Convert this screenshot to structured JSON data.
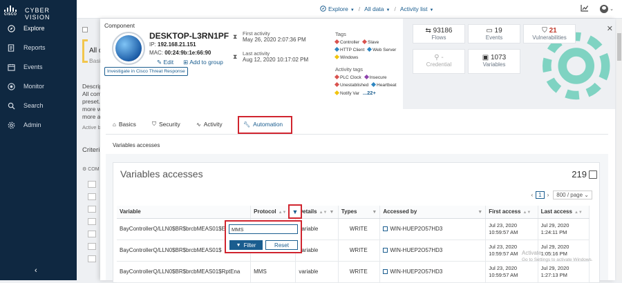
{
  "sidebar": {
    "brand": "CYBER VISION",
    "logo_text": "CISCO",
    "items": [
      {
        "label": "Explore",
        "icon": "compass-icon"
      },
      {
        "label": "Reports",
        "icon": "report-icon"
      },
      {
        "label": "Events",
        "icon": "calendar-icon"
      },
      {
        "label": "Monitor",
        "icon": "monitor-icon"
      },
      {
        "label": "Search",
        "icon": "search-icon"
      },
      {
        "label": "Admin",
        "icon": "gear-icon"
      }
    ],
    "collapse": "‹"
  },
  "topbar": {
    "crumbs": [
      "Explore",
      "All data",
      "Activity list"
    ],
    "chart_icon": "chart-icon",
    "user_icon": "user-icon"
  },
  "background": {
    "all_d": "All d",
    "basic": "Basic",
    "descript": "Descript",
    "line1": "All comp",
    "line2": "preset. T",
    "line3": "more w",
    "line4": "more ac",
    "active": "Active b",
    "criteria": "Criteri",
    "com": "COM"
  },
  "component": {
    "label": "Component",
    "name": "DESKTOP-L3RN1PF",
    "ip_label": "IP:",
    "ip": "192.168.21.151",
    "mac_label": "MAC:",
    "mac": "00:24:9b:1e:66:90",
    "edit": "Edit",
    "add_group": "Add to group",
    "investigate": "Investigate in Cisco Threat Response",
    "first_activity_label": "First activity",
    "first_activity": "May 26, 2020 2:07:36 PM",
    "last_activity_label": "Last activity",
    "last_activity": "Aug 12, 2020 10:17:02 PM",
    "tags_label": "Tags",
    "tags": [
      {
        "name": "Controller",
        "color": "#d9534f"
      },
      {
        "name": "Slave",
        "color": "#d9534f"
      },
      {
        "name": "HTTP Client",
        "color": "#2e86c1"
      },
      {
        "name": "Web Server",
        "color": "#2e86c1"
      },
      {
        "name": "Windows",
        "color": "#f1c40f"
      }
    ],
    "activity_tags_label": "Activity tags",
    "activity_tags": [
      {
        "name": "PLC Clock",
        "color": "#d9534f"
      },
      {
        "name": "Insecure",
        "color": "#8e44ad"
      },
      {
        "name": "Unestablished",
        "color": "#d9534f"
      },
      {
        "name": "Heartbeat",
        "color": "#2e86c1"
      },
      {
        "name": "Notify Var",
        "color": "#f1c40f"
      }
    ],
    "more_tags": "...22+"
  },
  "stats": {
    "flows": {
      "value": "93186",
      "label": "Flows"
    },
    "events": {
      "value": "19",
      "label": "Events"
    },
    "vulnerabilities": {
      "value": "21",
      "label": "Vulnerabilities"
    },
    "credential": {
      "value": "-",
      "label": "Credential"
    },
    "variables": {
      "value": "1073",
      "label": "Variables"
    }
  },
  "tabs": [
    {
      "label": "Basics",
      "icon": "home-icon"
    },
    {
      "label": "Security",
      "icon": "shield-icon"
    },
    {
      "label": "Activity",
      "icon": "pulse-icon"
    },
    {
      "label": "Automation",
      "icon": "wrench-icon"
    }
  ],
  "subtitle": "Variables accesses",
  "variables": {
    "title": "Variables accesses",
    "count": "219",
    "page": "1",
    "per_page": "800 / page",
    "columns": [
      "Variable",
      "Protocol",
      "Details",
      "Types",
      "Accessed by",
      "First access",
      "Last access"
    ],
    "rows": [
      {
        "variable": "BayControllerQ/LLN0$BR$brcbMEAS01$E",
        "protocol": "",
        "details": "variable",
        "type": "WRITE",
        "accessed_by": "WIN-HUEP2O57HD3",
        "first_date": "Jul 23, 2020",
        "first_time": "10:59:57 AM",
        "last_date": "Jul 29, 2020",
        "last_time": "1:24:11 PM"
      },
      {
        "variable": "BayControllerQ/LLN0$BR$brcbMEAS01$",
        "protocol": "",
        "details": "variable",
        "type": "WRITE",
        "accessed_by": "WIN-HUEP2O57HD3",
        "first_date": "Jul 23, 2020",
        "first_time": "10:59:57 AM",
        "last_date": "Jul 29, 2020",
        "last_time": "1:05:16 PM"
      },
      {
        "variable": "BayControllerQ/LLN0$BR$brcbMEAS01$RptEna",
        "protocol": "MMS",
        "details": "variable",
        "type": "WRITE",
        "accessed_by": "WIN-HUEP2O57HD3",
        "first_date": "Jul 23, 2020",
        "first_time": "10:59:57 AM",
        "last_date": "Jul 29, 2020",
        "last_time": "1:27:13 PM"
      }
    ]
  },
  "filter_popup": {
    "value": "MMS",
    "filter_btn": "Filter",
    "reset_btn": "Reset"
  },
  "watermark": {
    "line1": "Activate",
    "line2": "Go to Settings to activate Windows."
  },
  "colors": {
    "sidebar": "#0f2841",
    "accent": "#1a5d8f",
    "highlight": "#d0242e",
    "write": "#e67e22",
    "gear": "#7fd3c2"
  }
}
